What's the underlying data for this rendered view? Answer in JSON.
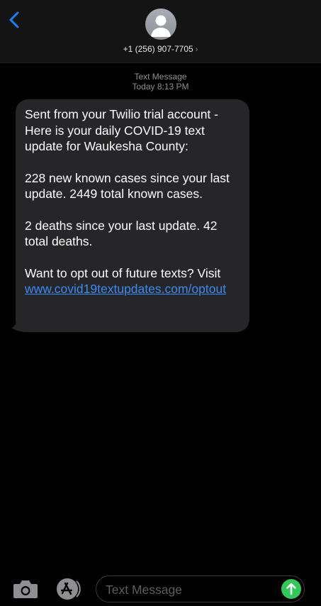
{
  "header": {
    "contact": "+1 (256) 907-7705",
    "chevron": "›",
    "icons": {
      "back": "chevron-left-icon",
      "avatar": "person-icon"
    },
    "back_color": "#1a82f7"
  },
  "meta": {
    "type": "Text Message",
    "time": "Today 8:13 PM"
  },
  "message": {
    "p1": "Sent from your Twilio trial account - Here is your daily COVID-19 text update for Waukesha County:",
    "p2": "228 new known cases since your last update. 2449 total known cases.",
    "p3": "2 deaths since your last update. 42 total deaths.",
    "p4_text": "Want to opt out of future texts? Visit",
    "link": "www.covid19textupdates.com/optout",
    "bubble_color": "#262629",
    "link_color": "#3b8bf5"
  },
  "composer": {
    "placeholder": "Text Message",
    "icons": {
      "camera": "camera-icon",
      "apps": "app-store-icon",
      "send": "arrow-up-icon"
    },
    "send_color": "#32c759"
  }
}
